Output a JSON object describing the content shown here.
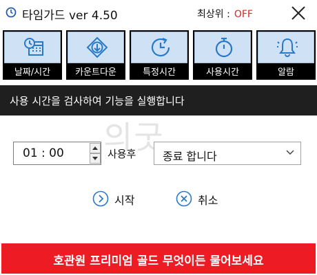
{
  "window": {
    "title": "타임가드 ver 4.50",
    "topmost_label": "최상위 :",
    "topmost_state": "OFF",
    "colors": {
      "topmost_off": "#e02020"
    }
  },
  "toolbar": {
    "items": [
      {
        "label": "날짜/시간",
        "icon": "calendar-clock-icon"
      },
      {
        "label": "카운트다운",
        "icon": "download-arrow-icon"
      },
      {
        "label": "특정시간",
        "icon": "clock-refresh-icon"
      },
      {
        "label": "사용시간",
        "icon": "stopwatch-icon"
      },
      {
        "label": "알람",
        "icon": "bell-icon"
      }
    ]
  },
  "message": "사용 시간을 검사하여 기능을 실행합니다",
  "watermark": "의굿",
  "form": {
    "time_value": "01 : 00",
    "after_label": "사용후",
    "action_selected": "종료 합니다"
  },
  "buttons": {
    "start": "시작",
    "cancel": "취소"
  },
  "banner": {
    "text": "호관원 프리미엄 골드 무엇이든 물어보세요",
    "color": "#ed1c24"
  }
}
